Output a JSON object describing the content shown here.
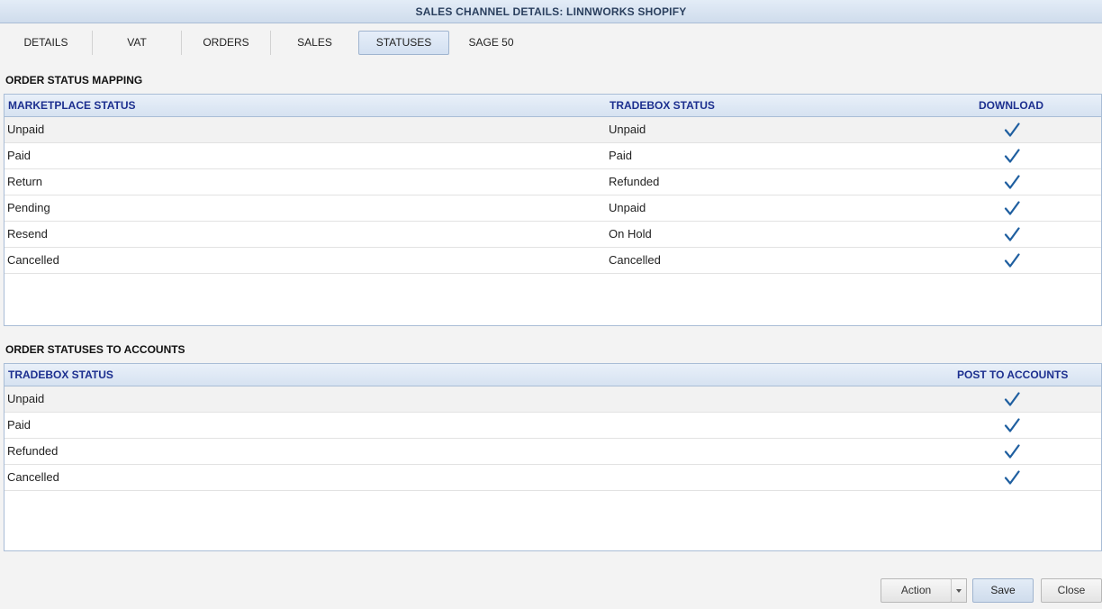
{
  "window": {
    "title": "SALES CHANNEL DETAILS: LINNWORKS SHOPIFY"
  },
  "tabs": [
    {
      "label": "DETAILS"
    },
    {
      "label": "VAT"
    },
    {
      "label": "ORDERS"
    },
    {
      "label": "SALES"
    },
    {
      "label": "STATUSES",
      "active": true
    },
    {
      "label": "SAGE 50"
    }
  ],
  "mapping": {
    "title": "ORDER STATUS MAPPING",
    "columns": {
      "marketplace": "MARKETPLACE STATUS",
      "tradebox": "TRADEBOX STATUS",
      "download": "DOWNLOAD"
    },
    "rows": [
      {
        "marketplace": "Unpaid",
        "tradebox": "Unpaid",
        "download": true
      },
      {
        "marketplace": "Paid",
        "tradebox": "Paid",
        "download": true
      },
      {
        "marketplace": "Return",
        "tradebox": "Refunded",
        "download": true
      },
      {
        "marketplace": "Pending",
        "tradebox": "Unpaid",
        "download": true
      },
      {
        "marketplace": "Resend",
        "tradebox": "On Hold",
        "download": true
      },
      {
        "marketplace": "Cancelled",
        "tradebox": "Cancelled",
        "download": true
      }
    ]
  },
  "accounts": {
    "title": "ORDER STATUSES TO ACCOUNTS",
    "columns": {
      "tradebox": "TRADEBOX STATUS",
      "post": "POST TO ACCOUNTS"
    },
    "rows": [
      {
        "tradebox": "Unpaid",
        "post": true
      },
      {
        "tradebox": "Paid",
        "post": true
      },
      {
        "tradebox": "Refunded",
        "post": true
      },
      {
        "tradebox": "Cancelled",
        "post": true
      }
    ]
  },
  "footer": {
    "action_label": "Action",
    "save_label": "Save",
    "close_label": "Close"
  },
  "colors": {
    "check": "#1f5fa0",
    "header_text": "#1c2f8f",
    "accent": "#cfdcec"
  },
  "icons": {
    "check": "checkmark-icon",
    "dropdown": "chevron-down-icon"
  }
}
